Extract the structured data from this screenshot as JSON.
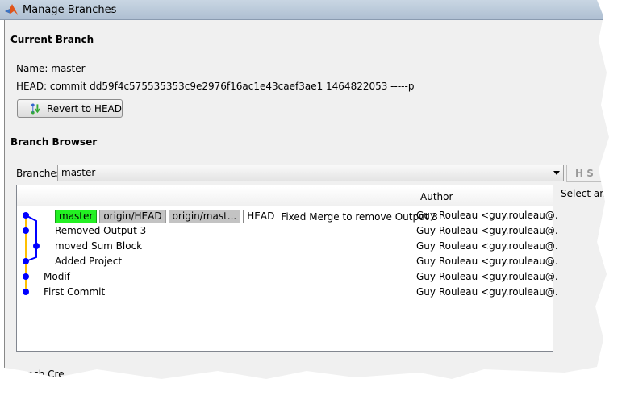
{
  "window": {
    "title": "Manage Branches"
  },
  "current_branch": {
    "heading": "Current Branch",
    "name": "Name: master",
    "head": "HEAD: commit dd59f4c575535353c9e2976f16ac1e43caef3ae1 1464822053 -----p",
    "revert_label": "Revert to HEAD"
  },
  "branch_browser": {
    "heading": "Branch Browser",
    "branches_label": "Branches:",
    "branches_value": "master",
    "side_button": "S",
    "columns": [
      "",
      "Author"
    ],
    "rows": [
      {
        "tags": [
          {
            "label": "master",
            "style": "green"
          },
          {
            "label": "origin/HEAD",
            "style": "gray"
          },
          {
            "label": "origin/mast...",
            "style": "gray"
          },
          {
            "label": "HEAD",
            "style": "white"
          }
        ],
        "message": "Fixed Merge to remove Output 3",
        "author": "Guy Rouleau <guy.rouleau@..."
      },
      {
        "tags": [],
        "message": "Removed Output 3",
        "author": "Guy Rouleau <guy.rouleau@..."
      },
      {
        "tags": [],
        "message": "moved Sum Block",
        "author": "Guy Rouleau <guy.rouleau@..."
      },
      {
        "tags": [],
        "message": "Added Project",
        "author": "Guy Rouleau <guy.rouleau@..."
      },
      {
        "tags": [],
        "message": "Modif",
        "author": "Guy Rouleau <guy.rouleau@..."
      },
      {
        "tags": [],
        "message": "First Commit",
        "author": "Guy Rouleau <guy.rouleau@..."
      }
    ],
    "details_text": "Select an e"
  },
  "next_section": "Branch Cre",
  "colors": {
    "graph_node": "#0000ff",
    "main_line": "#ffc000",
    "branch_line": "#0000ff",
    "tag_local": "#22f022",
    "tag_remote": "#c3c3c3"
  }
}
